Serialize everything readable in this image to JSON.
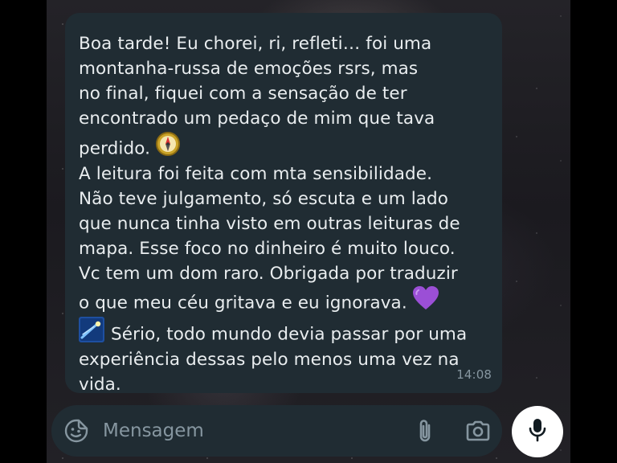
{
  "message": {
    "lines": [
      "Boa tarde! Eu chorei, ri, refleti… foi uma",
      "montanha-russa de emoções rsrs, mas",
      "no final, fiquei com a sensação de ter",
      "encontrado um pedaço de mim que tava",
      "perdido.",
      "A leitura foi feita com mta sensibilidade.",
      "Não teve julgamento, só escuta e um lado",
      "que nunca tinha visto em outras leituras de",
      "mapa. Esse foco no dinheiro é muito louco.",
      "Vc tem um dom raro. Obrigada por traduzir",
      "o que meu céu gritava e eu ignorava.",
      "Sério, todo mundo devia passar por uma",
      "experiência dessas pelo menos uma vez na",
      "vida."
    ],
    "time": "14:08",
    "emojis": [
      "compass-emoji",
      "purple-heart-emoji",
      "shooting-star-emoji"
    ]
  },
  "composer": {
    "placeholder": "Mensagem",
    "icons": [
      "sticker-icon",
      "paperclip-icon",
      "camera-icon",
      "microphone-icon"
    ]
  },
  "colors": {
    "bubble": "#202c33",
    "text": "#e9edef",
    "muted": "#8696a0",
    "mic_button": "#ffffff"
  }
}
